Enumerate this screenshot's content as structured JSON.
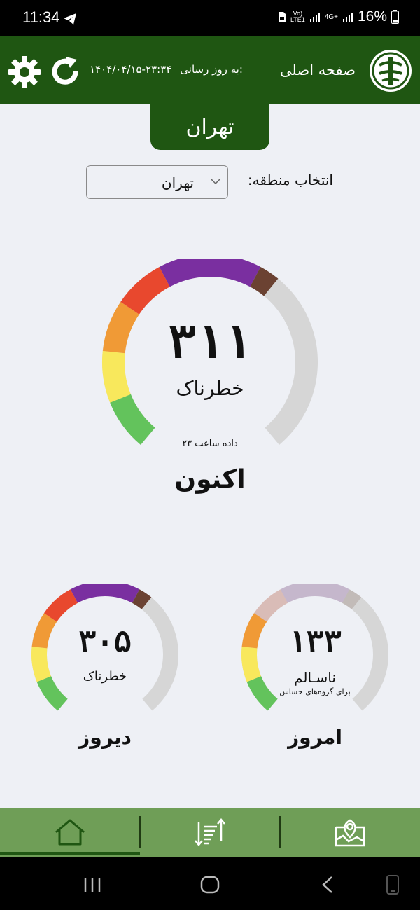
{
  "status_bar": {
    "time": "11:34",
    "network_label_1": "Vo)",
    "network_label_2": "LTE1",
    "network_label_3": "4G+",
    "battery": "16%"
  },
  "header": {
    "home_title": "صفحه اصلی",
    "update_label": "به روز رسانی:",
    "update_value": "۱۴۰۴/۰۴/۱۵-۲۳:۳۴",
    "icons": [
      "settings-icon",
      "refresh-icon",
      "logo"
    ]
  },
  "city": "تهران",
  "region": {
    "label": "انتخاب منطقه:",
    "selected": "تهران"
  },
  "gauges": {
    "now": {
      "value": "۳۱۱",
      "status": "خطرناک",
      "note": "داده ساعت ۲۳",
      "caption": "اکنون",
      "level": 311
    },
    "yesterday": {
      "value": "۳۰۵",
      "status": "خطرناک",
      "caption": "دیروز",
      "level": 305
    },
    "today": {
      "value": "۱۳۳",
      "status": "ناسـالم",
      "note": "برای گروه‌های حساس",
      "caption": "امروز",
      "level": 133
    }
  },
  "colors": {
    "header": "#1f5612",
    "good": "#63c35c",
    "moderate": "#f8e85c",
    "sensitive": "#f09a36",
    "unhealthy": "#e8482e",
    "very_unhealthy": "#7a2fa0",
    "hazardous": "#6b4232",
    "track": "#d6d6d6"
  },
  "bottom_nav": {
    "items": [
      "home-icon",
      "sort-icon",
      "map-icon"
    ]
  }
}
